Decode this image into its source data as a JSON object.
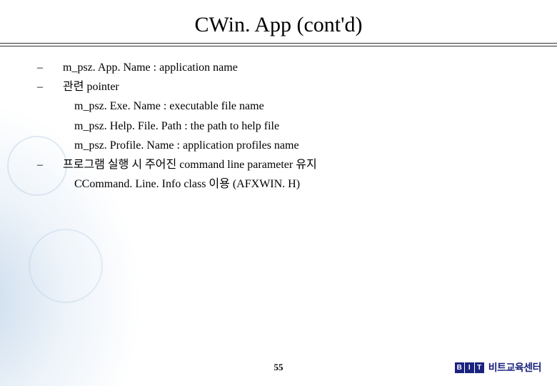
{
  "title": "CWin. App (cont'd)",
  "bullets": {
    "b1": "m_psz. App. Name : application name",
    "b2": "관련 pointer",
    "b2_sub1": "m_psz. Exe. Name : executable file name",
    "b2_sub2": "m_psz. Help. File. Path : the path to help file",
    "b2_sub3": "m_psz. Profile. Name : application profiles name",
    "b3": "프로그램 실행 시 주어진 command line parameter 유지",
    "b3_sub1": "CCommand. Line. Info class 이용 (AFXWIN. H)"
  },
  "page_number": "55",
  "brand": {
    "logo_letters": [
      "B",
      "I",
      "T"
    ],
    "text": "비트교육센터"
  }
}
